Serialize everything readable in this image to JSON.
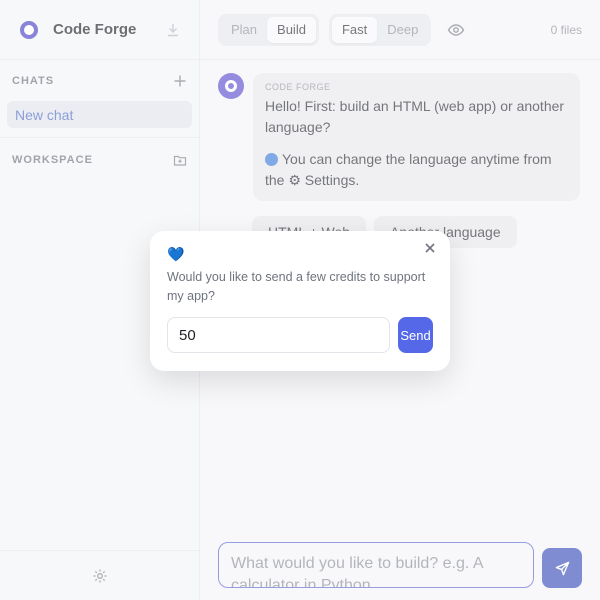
{
  "sidebar": {
    "brand": "Code Forge",
    "chats_label": "CHATS",
    "chat_items": [
      "New chat"
    ],
    "workspace_label": "WORKSPACE"
  },
  "topbar": {
    "mode_options": [
      "Plan",
      "Build"
    ],
    "mode_selected": "Build",
    "speed_options": [
      "Fast",
      "Deep"
    ],
    "speed_selected": "Fast",
    "files": "0 files"
  },
  "message": {
    "sender": "CODE FORGE",
    "line1": "Hello! First: build an HTML (web app) or another language?",
    "line2": "You can change the language anytime from the ⚙ Settings."
  },
  "choices": [
    "HTML + Web",
    "Another language"
  ],
  "composer": {
    "placeholder": "What would you like to build? e.g. A calculator in Python"
  },
  "modal": {
    "emoji": "💙",
    "text": "Would you like to send a few credits to support my app?",
    "input_value": "50",
    "send_label": "Send"
  },
  "colors": {
    "accent": "#5468e8",
    "brand": "#4a43c4",
    "chat_active_text": "#4e6bc2"
  }
}
